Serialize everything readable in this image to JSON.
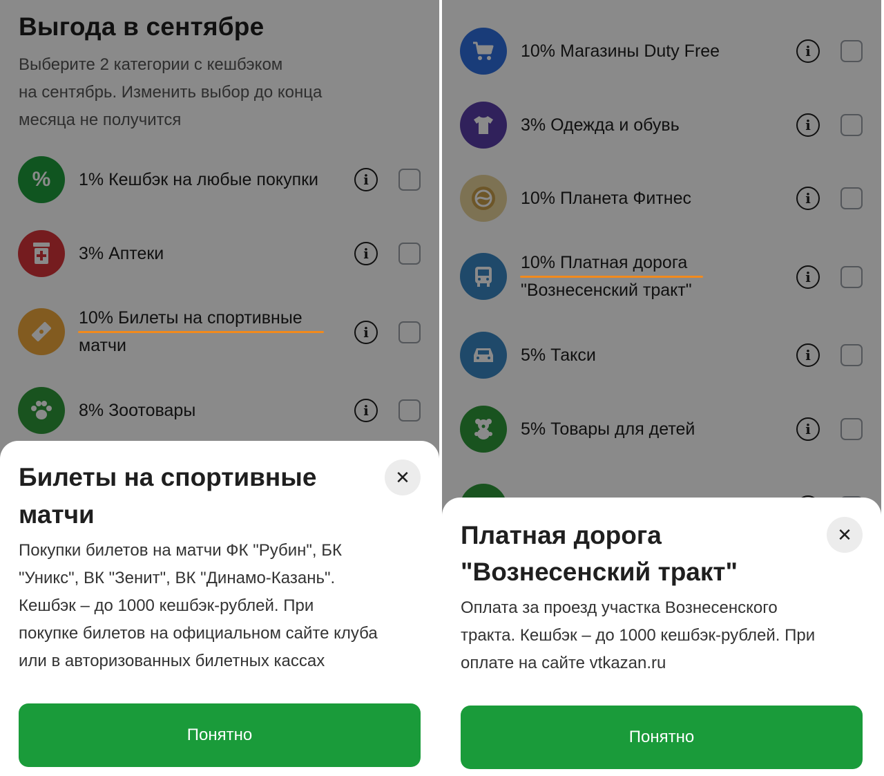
{
  "left": {
    "heading": "Выгода в сентябре",
    "subheading_lines": [
      "Выберите 2 категории  с кешбэком",
      "на сентябрь. Изменить выбор до конца",
      "месяца не получится"
    ],
    "categories": [
      {
        "label": "1% Кешбэк на любые покупки",
        "icon": "percent-icon",
        "color": "#1e9e3c"
      },
      {
        "label": "3% Аптеки",
        "icon": "pharmacy-icon",
        "color": "#d9343a"
      },
      {
        "label_line1": "10% Билеты на спортивные",
        "label_line2": "матчи",
        "icon": "ticket-icon",
        "color": "#f0a93b"
      },
      {
        "label": "8% Зоотовары",
        "icon": "paw-icon",
        "color": "#2f9a3a"
      }
    ],
    "sheet": {
      "title_line1": "Билеты на спортивные",
      "title_line2": "матчи",
      "body_lines": [
        "Покупки билетов на матчи ФК \"Рубин\", БК",
        "\"Уникс\", ВК \"Зенит\", ВК \"Динамо-Казань\".",
        "Кешбэк – до 1000 кешбэк-рублей. При",
        "покупке билетов на официальном сайте клуба",
        "или в авторизованных билетных кассах"
      ],
      "button": "Понятно",
      "close": "✕"
    }
  },
  "right": {
    "categories": [
      {
        "label": "10% Магазины Duty Free",
        "icon": "cart-icon",
        "color": "#2f6fe0"
      },
      {
        "label": "3% Одежда и обувь",
        "icon": "tshirt-icon",
        "color": "#5a3ea8"
      },
      {
        "label": "10% Планета Фитнес",
        "icon": "planet-fitness-icon",
        "color": "#c9a04a"
      },
      {
        "label_line1": "10% Платная дорога",
        "label_line2": "\"Вознесенский тракт\"",
        "icon": "bus-icon",
        "color": "#3a88c5"
      },
      {
        "label": "5% Такси",
        "icon": "taxi-icon",
        "color": "#3a88c5"
      },
      {
        "label": "5% Товары для детей",
        "icon": "teddy-bear-icon",
        "color": "#2f9a3a"
      }
    ],
    "sheet": {
      "title_line1": "Платная дорога",
      "title_line2": "\"Вознесенский тракт\"",
      "body_lines": [
        "Оплата за проезд участка Вознесенского",
        "тракта. Кешбэк – до 1000 кешбэк-рублей. При",
        "оплате на сайте vtkazan.ru"
      ],
      "button": "Понятно",
      "close": "✕"
    }
  },
  "colors": {
    "accent": "#1a9b3a",
    "highlight": "#f28a1c"
  }
}
